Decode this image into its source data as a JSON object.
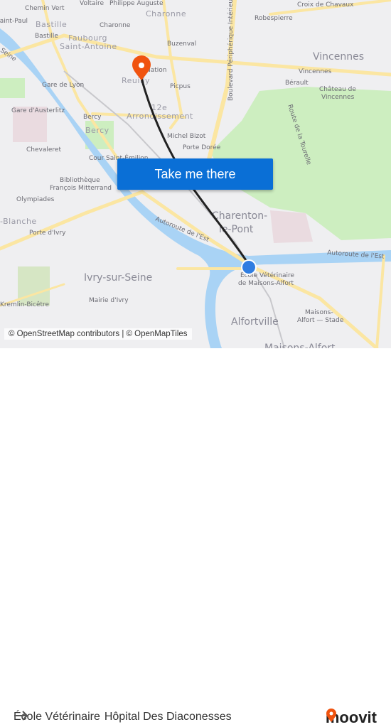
{
  "map": {
    "labels": {
      "chemin_vert": "Chemin Vert",
      "voltaire": "Voltaire",
      "philippe_auguste": "Philippe Auguste",
      "charonne_district": "Charonne",
      "saint_paul": "Saint-Paul",
      "bastille_district": "Bastille",
      "bastille": "Bastille",
      "charonne": "Charonne",
      "faubourg": "Faubourg",
      "saint_antoine": "Saint-Antoine",
      "buzenval": "Buzenval",
      "nation": "Nation",
      "reuilly": "Reuilly",
      "picpus": "Picpus",
      "gare_de_lyon": "Gare de Lyon",
      "gare_austerlitz": "Gare d'Austerlitz",
      "bercy": "Bercy",
      "bercy_district": "Bercy",
      "arr_12e": "12e",
      "arrondissement": "Arrondissement",
      "michel_bizot": "Michel Bizot",
      "porte_doree": "Porte Dorée",
      "chevaleret": "Chevaleret",
      "cour_saint_emilion": "Cour Saint-Émilion",
      "bibliotheque": "Bibliothèque",
      "francois_mitterrand": "François Mitterrand",
      "olympiades": "Olympiades",
      "maison_blanche": "-Blanche",
      "porte_ivry": "Porte d'Ivry",
      "croix_chavaux": "Croix de Chavaux",
      "robespierre": "Robespierre",
      "peripherique": "Boulevard Périphérique Intérieur",
      "vincennes_city": "Vincennes",
      "vincennes": "Vincennes",
      "berault": "Bérault",
      "chateau": "Château de",
      "chateau2": "Vincennes",
      "route_tourelle": "Route de la Tourelle",
      "charenton": "Charenton-",
      "le_pont": "le-Pont",
      "autoroute_est": "Autoroute de l'Est",
      "autoroute_est2": "Autoroute de l'Est",
      "ivry": "Ivry-sur-Seine",
      "mairie_ivry": "Mairie d'Ivry",
      "kremlin": "Kremlin-Bicêtre",
      "ecole_vet": "École Vétérinaire",
      "ecole_vet2": "de Maisons-Alfort",
      "alfortville": "Alfortville",
      "maisons_stade": "Maisons-",
      "maisons_stade2": "Alfort — Stade",
      "maisons_alfort": "Maisons-Alfort",
      "seine": "Seine"
    },
    "colors": {
      "water": "#a9d3f5",
      "park": "#cdeec0",
      "road": "#fbe6a2",
      "route": "#222222",
      "origin": "#2f7de1",
      "destination": "#f0530f"
    },
    "origin_icon": "blue-dot-icon",
    "destination_icon": "map-pin-icon"
  },
  "cta": {
    "label": "Take me there"
  },
  "attribution": "© OpenStreetMap contributors | © OpenMapTiles",
  "footer": {
    "from": "École Vétérinaire",
    "to": "Hôpital Des Diaconesses",
    "arrow_icon": "arrow-right-icon",
    "brand": "moovit"
  }
}
